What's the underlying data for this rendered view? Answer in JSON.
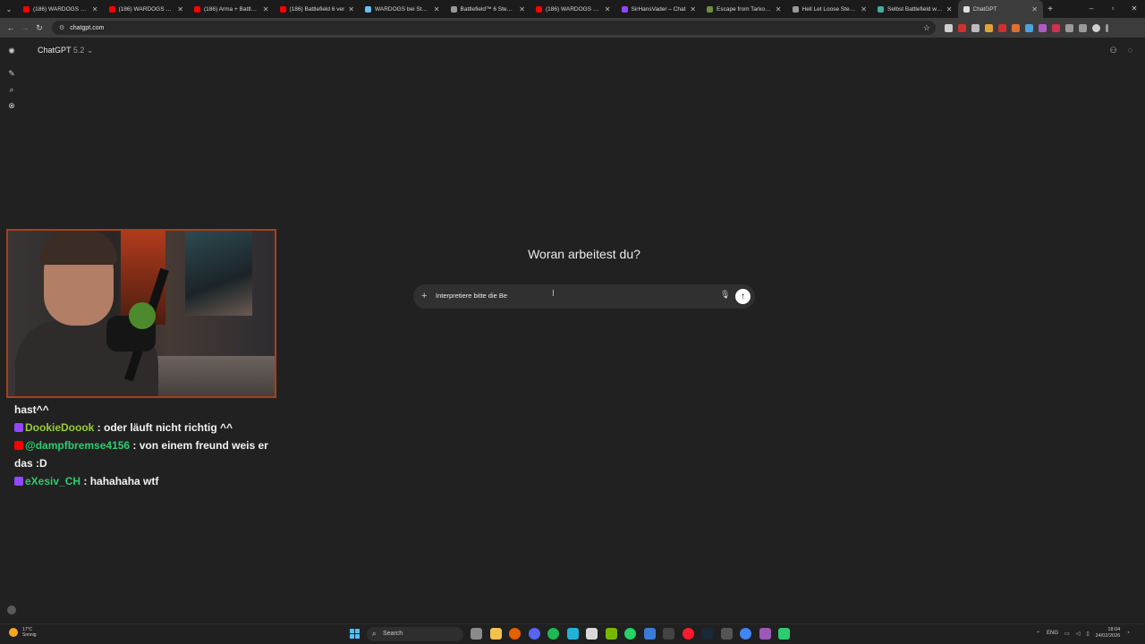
{
  "browser": {
    "tabs": [
      {
        "title": "(186) WARDOGS erklä",
        "fav_color": "#ff0000"
      },
      {
        "title": "(186) WARDOGS – Ga",
        "fav_color": "#ff0000"
      },
      {
        "title": "(186) Arma + Battlefie",
        "fav_color": "#ff0000"
      },
      {
        "title": "(186) Battlefield 6 ver",
        "fav_color": "#ff0000"
      },
      {
        "title": "WARDOGS bei Steam",
        "fav_color": "#66c0f4"
      },
      {
        "title": "Battlefield™ 6 Steam C",
        "fav_color": "#9a9a9a"
      },
      {
        "title": "(186) WARDOGS – Arc",
        "fav_color": "#ff0000"
      },
      {
        "title": "SirHansVader – Chat",
        "fav_color": "#9146ff"
      },
      {
        "title": "Escape from Tarkov – ",
        "fav_color": "#6f8f3a"
      },
      {
        "title": "Hell Let Loose Steam ",
        "fav_color": "#9a9a9a"
      },
      {
        "title": "Selbst Battlefield wag",
        "fav_color": "#3fb0a0"
      },
      {
        "title": "ChatGPT",
        "fav_color": "#e0e0e0",
        "active": true
      }
    ],
    "url": "chatgpt.com"
  },
  "app": {
    "model_name": "ChatGPT",
    "model_version": "5.2",
    "heading": "Woran arbeitest du?",
    "composer_text": "Interpretiere bitte die Be"
  },
  "stream_chat": {
    "lines": [
      {
        "user": "",
        "user_color": "#ffffff",
        "message": "hast^^",
        "badge_color": ""
      },
      {
        "user": "DookieDoook",
        "user_color": "#9acd32",
        "message": " : oder läuft nicht richtig ^^",
        "badge_color": "#9146ff"
      },
      {
        "user": "@dampfbremse4156",
        "user_color": "#2ecc71",
        "message": " : von einem freund weis er das :D",
        "badge_color": "#ff0000"
      },
      {
        "user": "eXesiv_CH",
        "user_color": "#2ecc71",
        "message": " : hahahaha wtf",
        "badge_color": "#9146ff"
      }
    ]
  },
  "taskbar": {
    "weather_temp": "17°C",
    "weather_text": "Sonnig",
    "search_placeholder": "Search",
    "language": "ENG",
    "time": "18:04",
    "date": "24/02/2026"
  },
  "colors": {
    "background": "#212121",
    "composer": "#303030",
    "webcam_border": "#a7401b"
  }
}
